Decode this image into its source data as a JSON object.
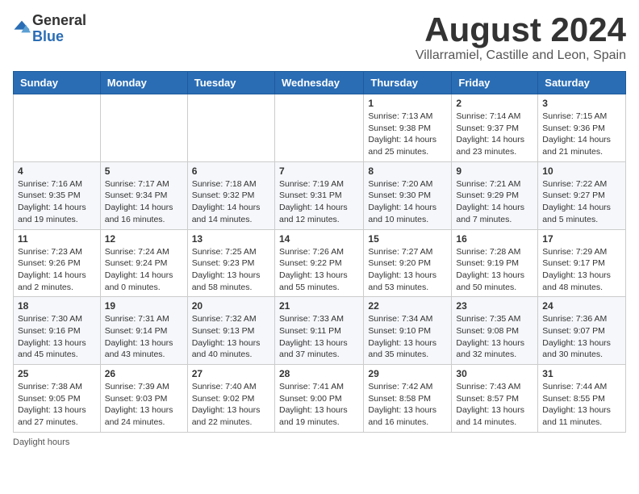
{
  "header": {
    "logo_general": "General",
    "logo_blue": "Blue",
    "month_title": "August 2024",
    "location": "Villarramiel, Castille and Leon, Spain"
  },
  "days_of_week": [
    "Sunday",
    "Monday",
    "Tuesday",
    "Wednesday",
    "Thursday",
    "Friday",
    "Saturday"
  ],
  "footer": "Daylight hours",
  "weeks": [
    [
      {
        "day": "",
        "info": ""
      },
      {
        "day": "",
        "info": ""
      },
      {
        "day": "",
        "info": ""
      },
      {
        "day": "",
        "info": ""
      },
      {
        "day": "1",
        "info": "Sunrise: 7:13 AM\nSunset: 9:38 PM\nDaylight: 14 hours and 25 minutes."
      },
      {
        "day": "2",
        "info": "Sunrise: 7:14 AM\nSunset: 9:37 PM\nDaylight: 14 hours and 23 minutes."
      },
      {
        "day": "3",
        "info": "Sunrise: 7:15 AM\nSunset: 9:36 PM\nDaylight: 14 hours and 21 minutes."
      }
    ],
    [
      {
        "day": "4",
        "info": "Sunrise: 7:16 AM\nSunset: 9:35 PM\nDaylight: 14 hours and 19 minutes."
      },
      {
        "day": "5",
        "info": "Sunrise: 7:17 AM\nSunset: 9:34 PM\nDaylight: 14 hours and 16 minutes."
      },
      {
        "day": "6",
        "info": "Sunrise: 7:18 AM\nSunset: 9:32 PM\nDaylight: 14 hours and 14 minutes."
      },
      {
        "day": "7",
        "info": "Sunrise: 7:19 AM\nSunset: 9:31 PM\nDaylight: 14 hours and 12 minutes."
      },
      {
        "day": "8",
        "info": "Sunrise: 7:20 AM\nSunset: 9:30 PM\nDaylight: 14 hours and 10 minutes."
      },
      {
        "day": "9",
        "info": "Sunrise: 7:21 AM\nSunset: 9:29 PM\nDaylight: 14 hours and 7 minutes."
      },
      {
        "day": "10",
        "info": "Sunrise: 7:22 AM\nSunset: 9:27 PM\nDaylight: 14 hours and 5 minutes."
      }
    ],
    [
      {
        "day": "11",
        "info": "Sunrise: 7:23 AM\nSunset: 9:26 PM\nDaylight: 14 hours and 2 minutes."
      },
      {
        "day": "12",
        "info": "Sunrise: 7:24 AM\nSunset: 9:24 PM\nDaylight: 14 hours and 0 minutes."
      },
      {
        "day": "13",
        "info": "Sunrise: 7:25 AM\nSunset: 9:23 PM\nDaylight: 13 hours and 58 minutes."
      },
      {
        "day": "14",
        "info": "Sunrise: 7:26 AM\nSunset: 9:22 PM\nDaylight: 13 hours and 55 minutes."
      },
      {
        "day": "15",
        "info": "Sunrise: 7:27 AM\nSunset: 9:20 PM\nDaylight: 13 hours and 53 minutes."
      },
      {
        "day": "16",
        "info": "Sunrise: 7:28 AM\nSunset: 9:19 PM\nDaylight: 13 hours and 50 minutes."
      },
      {
        "day": "17",
        "info": "Sunrise: 7:29 AM\nSunset: 9:17 PM\nDaylight: 13 hours and 48 minutes."
      }
    ],
    [
      {
        "day": "18",
        "info": "Sunrise: 7:30 AM\nSunset: 9:16 PM\nDaylight: 13 hours and 45 minutes."
      },
      {
        "day": "19",
        "info": "Sunrise: 7:31 AM\nSunset: 9:14 PM\nDaylight: 13 hours and 43 minutes."
      },
      {
        "day": "20",
        "info": "Sunrise: 7:32 AM\nSunset: 9:13 PM\nDaylight: 13 hours and 40 minutes."
      },
      {
        "day": "21",
        "info": "Sunrise: 7:33 AM\nSunset: 9:11 PM\nDaylight: 13 hours and 37 minutes."
      },
      {
        "day": "22",
        "info": "Sunrise: 7:34 AM\nSunset: 9:10 PM\nDaylight: 13 hours and 35 minutes."
      },
      {
        "day": "23",
        "info": "Sunrise: 7:35 AM\nSunset: 9:08 PM\nDaylight: 13 hours and 32 minutes."
      },
      {
        "day": "24",
        "info": "Sunrise: 7:36 AM\nSunset: 9:07 PM\nDaylight: 13 hours and 30 minutes."
      }
    ],
    [
      {
        "day": "25",
        "info": "Sunrise: 7:38 AM\nSunset: 9:05 PM\nDaylight: 13 hours and 27 minutes."
      },
      {
        "day": "26",
        "info": "Sunrise: 7:39 AM\nSunset: 9:03 PM\nDaylight: 13 hours and 24 minutes."
      },
      {
        "day": "27",
        "info": "Sunrise: 7:40 AM\nSunset: 9:02 PM\nDaylight: 13 hours and 22 minutes."
      },
      {
        "day": "28",
        "info": "Sunrise: 7:41 AM\nSunset: 9:00 PM\nDaylight: 13 hours and 19 minutes."
      },
      {
        "day": "29",
        "info": "Sunrise: 7:42 AM\nSunset: 8:58 PM\nDaylight: 13 hours and 16 minutes."
      },
      {
        "day": "30",
        "info": "Sunrise: 7:43 AM\nSunset: 8:57 PM\nDaylight: 13 hours and 14 minutes."
      },
      {
        "day": "31",
        "info": "Sunrise: 7:44 AM\nSunset: 8:55 PM\nDaylight: 13 hours and 11 minutes."
      }
    ]
  ]
}
